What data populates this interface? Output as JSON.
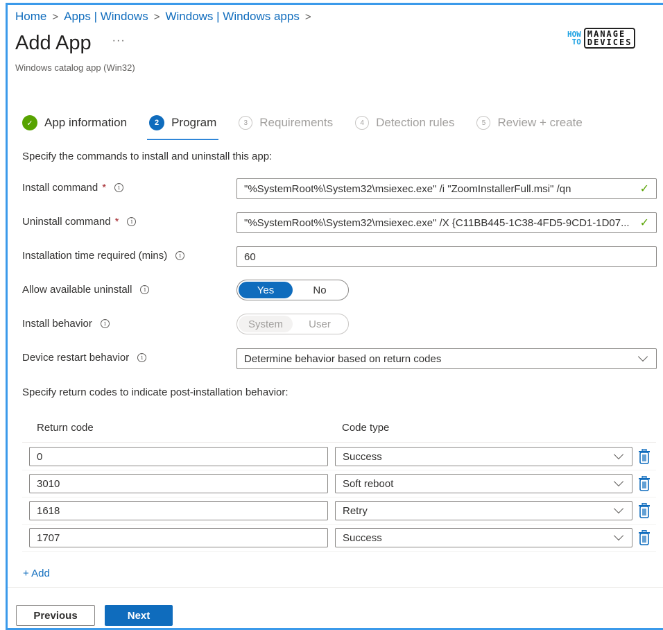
{
  "breadcrumb": [
    {
      "label": "Home"
    },
    {
      "label": "Apps | Windows"
    },
    {
      "label": "Windows | Windows apps"
    }
  ],
  "breadcrumb_separator": ">",
  "header": {
    "title": "Add App",
    "more_label": "···",
    "subtitle": "Windows catalog app (Win32)"
  },
  "logo": {
    "how": "HOW",
    "to": "TO",
    "line1": "MANAGE",
    "line2": "DEVICES"
  },
  "steps": [
    {
      "number": "✓",
      "label": "App information",
      "state": "done"
    },
    {
      "number": "2",
      "label": "Program",
      "state": "active"
    },
    {
      "number": "3",
      "label": "Requirements",
      "state": "pending"
    },
    {
      "number": "4",
      "label": "Detection rules",
      "state": "pending"
    },
    {
      "number": "5",
      "label": "Review + create",
      "state": "pending"
    }
  ],
  "intro": "Specify the commands to install and uninstall this app:",
  "fields": {
    "install_command": {
      "label": "Install command",
      "required": "*",
      "value": "\"%SystemRoot%\\System32\\msiexec.exe\" /i \"ZoomInstallerFull.msi\" /qn",
      "valid_icon": "✓"
    },
    "uninstall_command": {
      "label": "Uninstall command",
      "required": "*",
      "value": "\"%SystemRoot%\\System32\\msiexec.exe\" /X {C11BB445-1C38-4FD5-9CD1-1D07...",
      "valid_icon": "✓"
    },
    "install_time": {
      "label": "Installation time required (mins)",
      "value": "60"
    },
    "allow_uninstall": {
      "label": "Allow available uninstall",
      "options": [
        "Yes",
        "No"
      ],
      "selected": "Yes"
    },
    "install_behavior": {
      "label": "Install behavior",
      "options": [
        "System",
        "User"
      ],
      "selected": "System",
      "disabled": true
    },
    "restart_behavior": {
      "label": "Device restart behavior",
      "value": "Determine behavior based on return codes"
    }
  },
  "info_glyph": "i",
  "return_codes": {
    "intro": "Specify return codes to indicate post-installation behavior:",
    "col_code": "Return code",
    "col_type": "Code type",
    "rows": [
      {
        "code": "0",
        "type": "Success"
      },
      {
        "code": "3010",
        "type": "Soft reboot"
      },
      {
        "code": "1618",
        "type": "Retry"
      },
      {
        "code": "1707",
        "type": "Success"
      }
    ],
    "add_label": "+ Add"
  },
  "footer": {
    "previous": "Previous",
    "next": "Next"
  },
  "colors": {
    "accent": "#0f6cbd",
    "success": "#57a300",
    "frame": "#3b9aea",
    "required": "#a4262c"
  }
}
